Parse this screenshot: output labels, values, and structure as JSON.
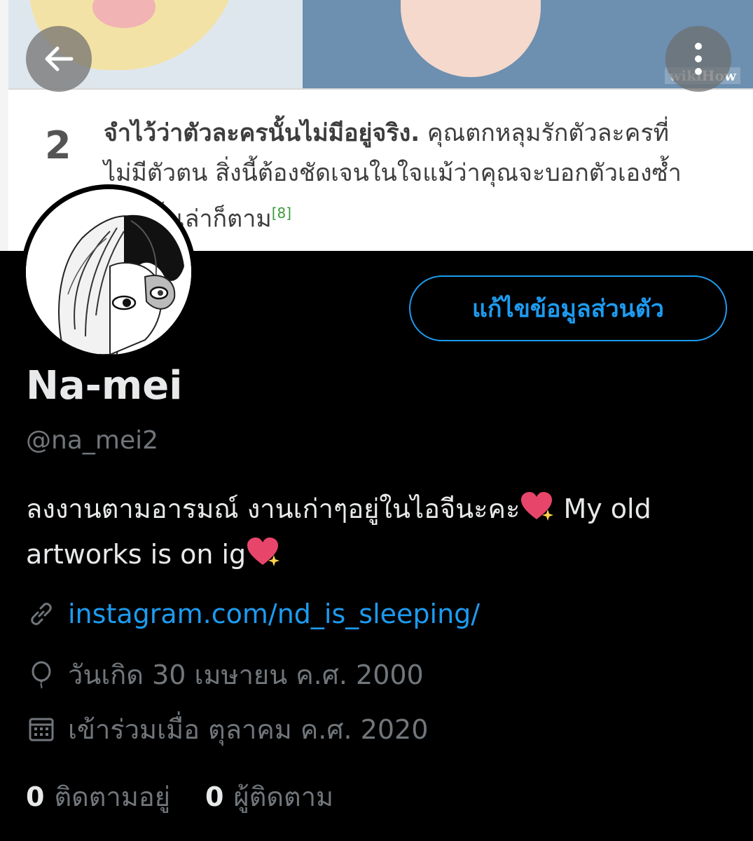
{
  "banner": {
    "watermark_prefix": "wiki",
    "watermark_suffix": "How",
    "step_number": "2",
    "step_lead": "จำไว้ว่าตัวละครนั้นไม่มีอยู่จริง.",
    "step_body": " คุณตกหลุมรักตัวละครที่ไม่มีตัวตน สิ่งนี้ต้องชัดเจนในใจแม้ว่าคุณจะบอกตัวเองซ้ำแล้วซ้ำเล่าก็ตาม",
    "step_ref": "[8]"
  },
  "nav": {
    "back_icon": "arrow-left-icon",
    "more_icon": "more-vertical-icon"
  },
  "profile": {
    "edit_label": "แก้ไขข้อมูลส่วนตัว",
    "display_name": "Na-mei",
    "handle": "@na_mei2",
    "bio_part1": "ลงงานตามอารมณ์ งานเก่าๆอยู่ในไอจีนะคะ",
    "bio_part2": " My old artworks is on ig",
    "website": "instagram.com/nd_is_sleeping/",
    "birthday": "วันเกิด 30 เมษายน ค.ศ. 2000",
    "joined": "เข้าร่วมเมื่อ ตุลาคม ค.ศ. 2020",
    "following_count": "0",
    "following_label": "ติดตามอยู่",
    "followers_count": "0",
    "followers_label": "ผู้ติดตาม"
  },
  "colors": {
    "accent": "#1d9bf0",
    "background": "#000000",
    "text_primary": "#e7e9ea",
    "text_secondary": "#71767b"
  }
}
